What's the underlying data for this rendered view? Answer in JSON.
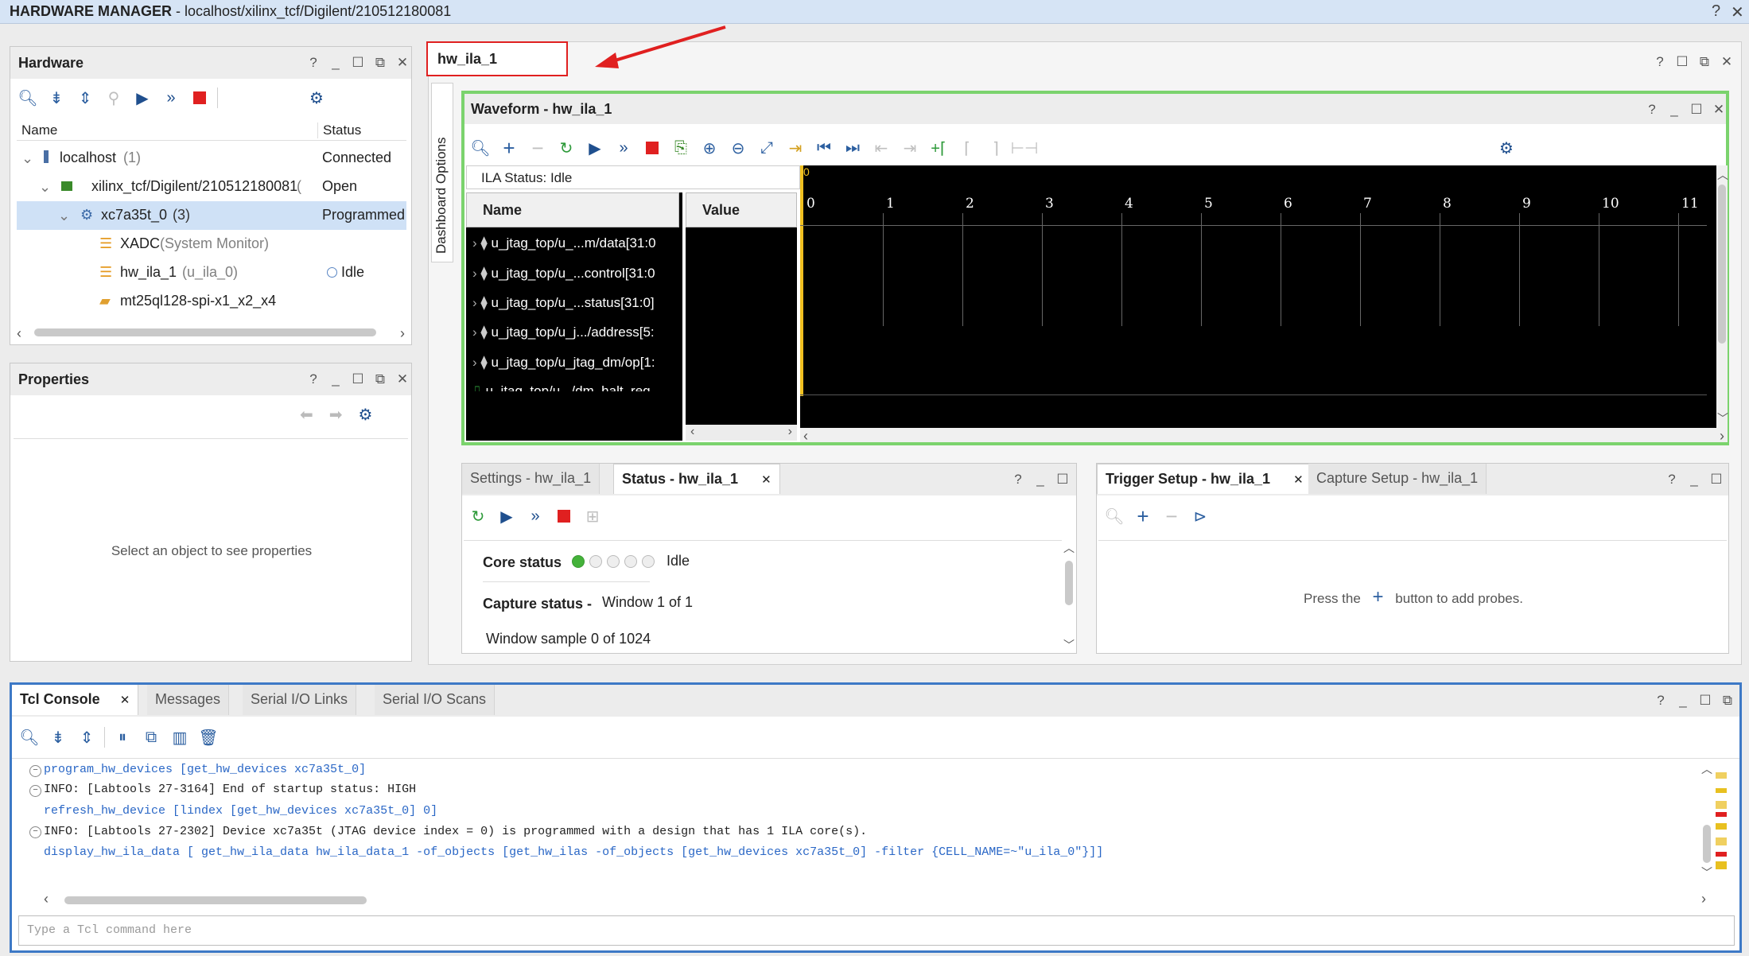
{
  "banner": {
    "app_title": "HARDWARE MANAGER",
    "path": " - localhost/xilinx_tcf/Digilent/210512180081",
    "help": "?",
    "close": "✕"
  },
  "hardware": {
    "title": "Hardware",
    "col_name": "Name",
    "col_status": "Status",
    "rows": [
      {
        "name": "localhost",
        "suffix": " (1)",
        "status": "Connected"
      },
      {
        "name": "xilinx_tcf/Digilent/210512180081",
        "suffix": " (",
        "status": "Open"
      },
      {
        "name": "xc7a35t_0",
        "suffix": " (3)",
        "status": "Programmed"
      },
      {
        "name": "XADC",
        "suffix": " (System Monitor)",
        "status": ""
      },
      {
        "name": "hw_ila_1",
        "suffix": " (u_ila_0)",
        "status": "Idle"
      },
      {
        "name": "mt25ql128-spi-x1_x2_x4",
        "suffix": "",
        "status": ""
      }
    ]
  },
  "properties": {
    "title": "Properties",
    "empty": "Select an object to see properties"
  },
  "main_tab": {
    "label": "hw_ila_1"
  },
  "dashboard": {
    "label": "Dashboard Options"
  },
  "waveform": {
    "title": "Waveform - hw_ila_1",
    "ila_status": "ILA Status:  Idle",
    "col_name": "Name",
    "col_value": "Value",
    "signals": [
      "u_jtag_top/u_...m/data[31:0",
      "u_jtag_top/u_...control[31:0",
      "u_jtag_top/u_...status[31:0]",
      "u_jtag_top/u_j.../address[5:",
      "u_jtag_top/u_jtag_dm/op[1:",
      "u_jtag_top/u.../dm_halt_req"
    ],
    "ticks": [
      "0",
      "1",
      "2",
      "3",
      "4",
      "5",
      "6",
      "7",
      "8",
      "9",
      "10",
      "11"
    ],
    "marker": "0"
  },
  "status_panel": {
    "tab_settings": "Settings - hw_ila_1",
    "tab_status": "Status - hw_ila_1",
    "core_status_label": "Core status",
    "core_status_value": "Idle",
    "capture_status_label": "Capture status -",
    "capture_status_value": "Window 1 of 1",
    "window_sample": "Window sample 0 of 1024"
  },
  "trigger_panel": {
    "tab_trigger": "Trigger Setup - hw_ila_1",
    "tab_capture": "Capture Setup - hw_ila_1",
    "hint_before": "Press the",
    "hint_after": "button to add probes."
  },
  "console": {
    "tab_tcl": "Tcl Console",
    "tab_messages": "Messages",
    "tab_serial_links": "Serial I/O Links",
    "tab_serial_scans": "Serial I/O Scans",
    "lines": [
      {
        "text": "program_hw_devices [get_hw_devices xc7a35t_0]",
        "kind": "cmd"
      },
      {
        "text": "INFO: [Labtools 27-3164] End of startup status: HIGH",
        "kind": "info"
      },
      {
        "text": "refresh_hw_device [lindex [get_hw_devices xc7a35t_0] 0]",
        "kind": "cmd"
      },
      {
        "text": "INFO: [Labtools 27-2302] Device xc7a35t (JTAG device index = 0) is programmed with a design that has 1 ILA core(s).",
        "kind": "info"
      },
      {
        "text": "display_hw_ila_data [ get_hw_ila_data hw_ila_data_1 -of_objects [get_hw_ilas -of_objects [get_hw_devices xc7a35t_0] -filter {CELL_NAME=~\"u_ila_0\"}]]",
        "kind": "cmd"
      }
    ],
    "input_placeholder": "Type a Tcl command here"
  },
  "colors": {
    "accent_blue": "#2a67c6",
    "waveform_border": "#7bd36d",
    "annotation_red": "#e02020",
    "console_border": "#3d79c6"
  }
}
